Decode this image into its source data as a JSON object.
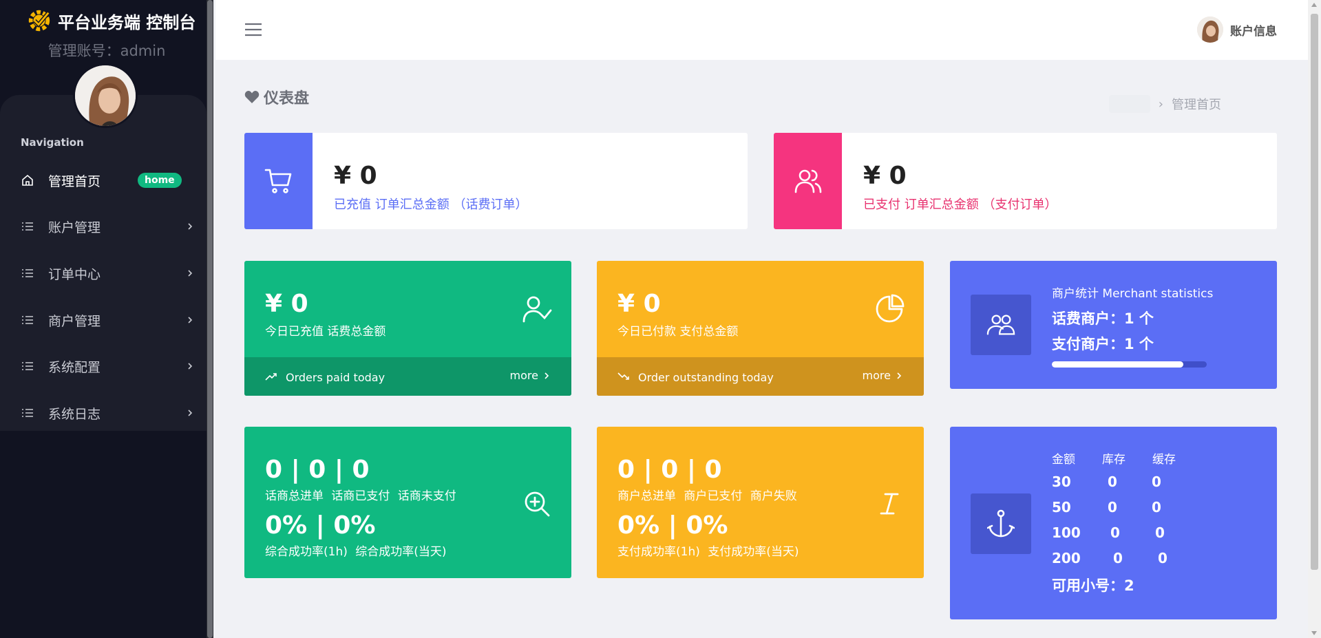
{
  "sidebar": {
    "brand_title": "平台业务端 控制台",
    "admin_label": "管理账号：",
    "admin_value": "admin",
    "nav_heading": "Navigation",
    "items": [
      {
        "label": "管理首页",
        "badge": "home"
      },
      {
        "label": "账户管理"
      },
      {
        "label": "订单中心"
      },
      {
        "label": "商户管理"
      },
      {
        "label": "系统配置"
      },
      {
        "label": "系统日志"
      }
    ]
  },
  "header": {
    "account_label": "账户信息"
  },
  "page": {
    "title": "仪表盘",
    "breadcrumb": "管理首页"
  },
  "summary": {
    "recharged": {
      "amount": "¥ 0",
      "desc": "已充值 订单汇总金额 （话费订单）",
      "color": "#5b6ef5"
    },
    "paid": {
      "amount": "¥ 0",
      "desc": "已支付 订单汇总金额 （支付订单）",
      "color": "#f5347f"
    }
  },
  "today": {
    "recharged": {
      "amount": "¥ 0",
      "sub": "今日已充值 话费总金额",
      "footer": "Orders paid today",
      "more": "more",
      "color": "#10b981",
      "footer_color": "#0e9668"
    },
    "paid": {
      "amount": "¥ 0",
      "sub": "今日已付款 支付总金额",
      "footer": "Order outstanding today",
      "more": "more",
      "color": "#fbb520",
      "footer_color": "#cf931e"
    }
  },
  "merchant_stats": {
    "title": "商户统计 Merchant statistics",
    "phone_merchants": "话费商户：1 个",
    "pay_merchants": "支付商户：1 个",
    "progress": 0.85
  },
  "phone_orders": {
    "counts": "0 | 0 | 0",
    "counts_labels": "话商总进单 话商已支付 话商未支付",
    "rates": "0% | 0%",
    "rates_labels": "综合成功率(1h) 综合成功率(当天)"
  },
  "pay_orders": {
    "counts": "0 | 0 | 0",
    "counts_labels": "商户总进单 商户已支付 商户失败",
    "rates": "0% | 0%",
    "rates_labels": "支付成功率(1h) 支付成功率(当天)"
  },
  "inventory": {
    "headers": [
      "金额",
      "库存",
      "缓存"
    ],
    "rows": [
      [
        "30",
        "0",
        "0"
      ],
      [
        "50",
        "0",
        "0"
      ],
      [
        "100",
        "0",
        "0"
      ],
      [
        "200",
        "0",
        "0"
      ]
    ],
    "available": "可用小号：2"
  }
}
